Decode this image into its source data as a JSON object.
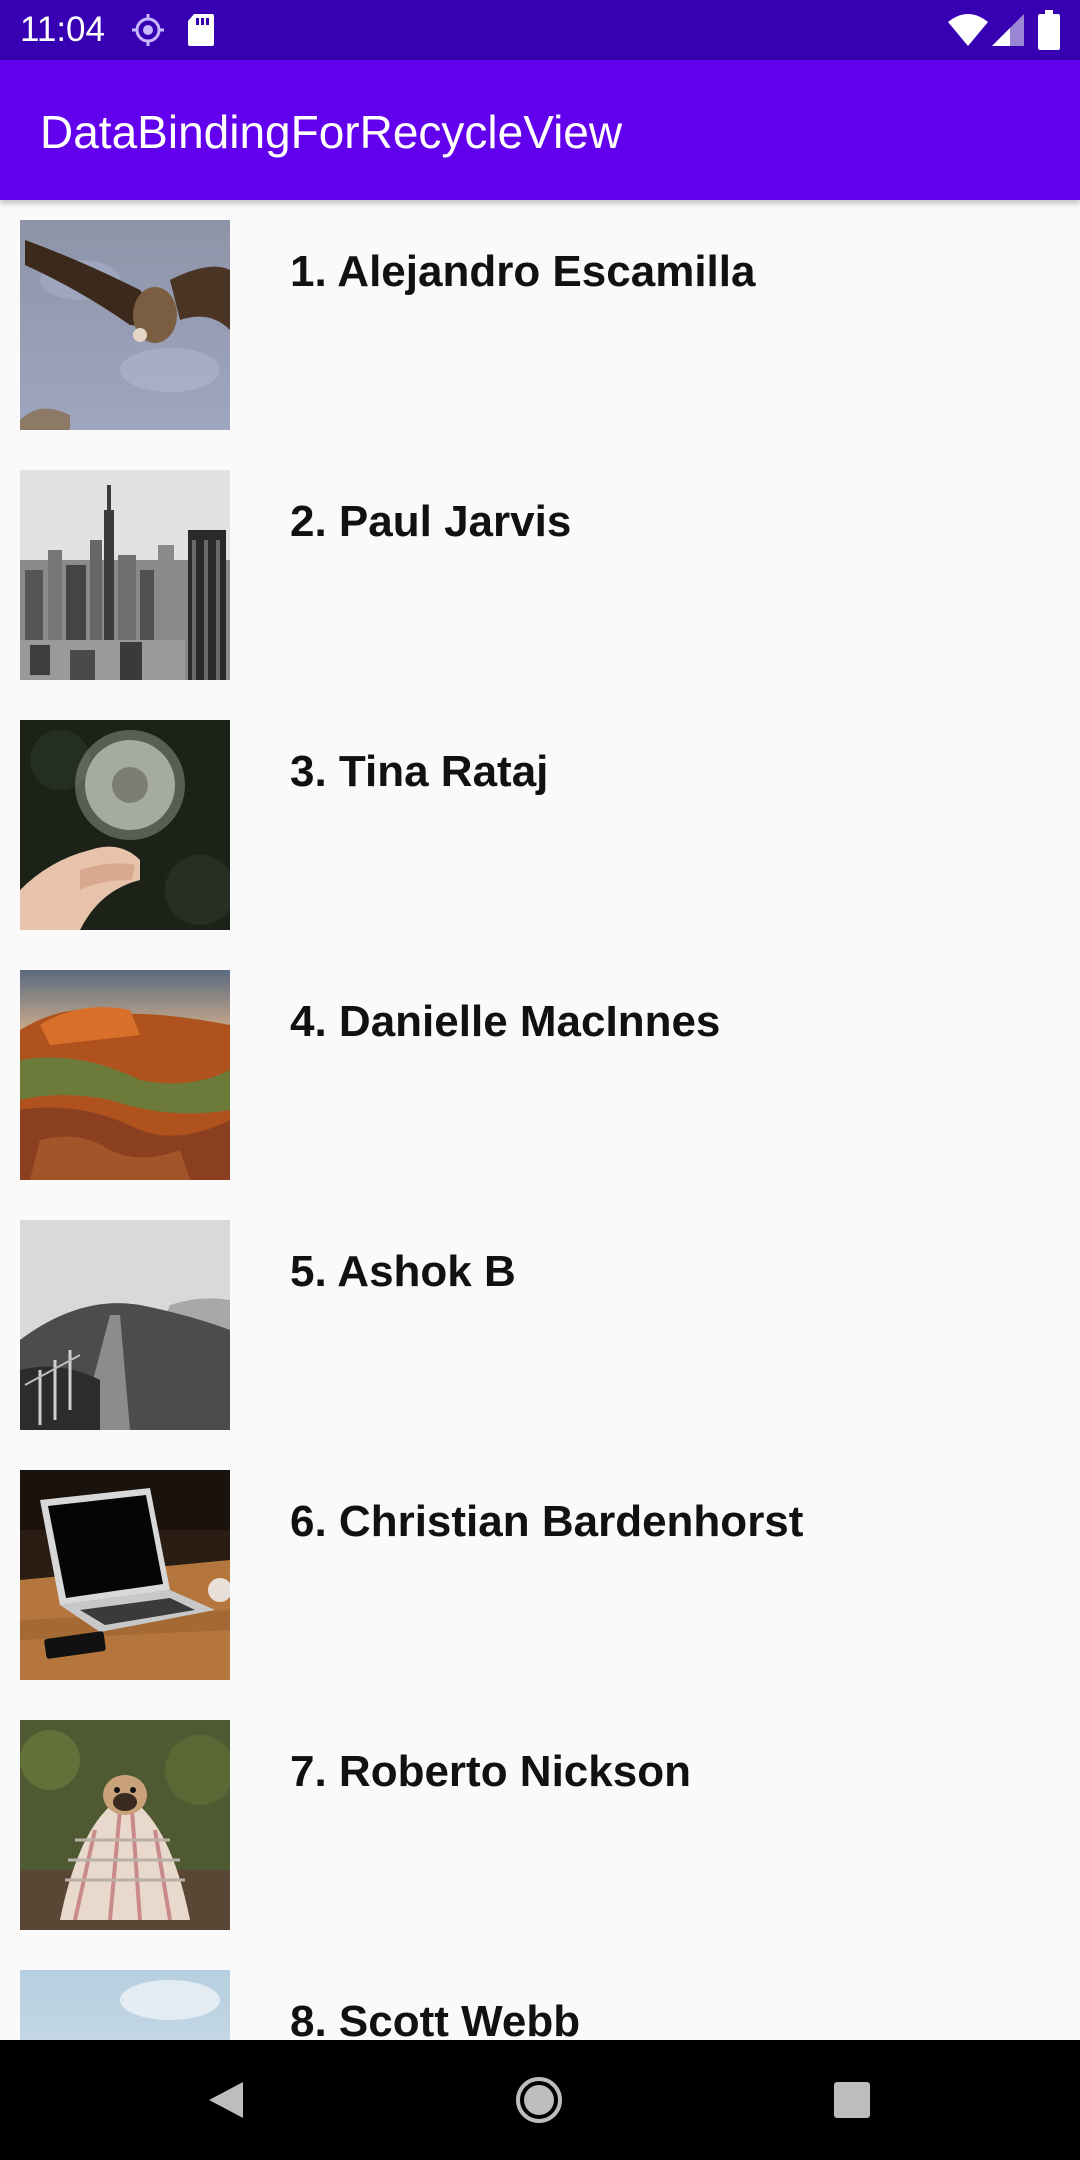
{
  "status_bar": {
    "time": "11:04",
    "icons": [
      "location-icon",
      "sd-card-icon",
      "wifi-icon",
      "signal-icon",
      "battery-icon"
    ]
  },
  "app_bar": {
    "title": "DataBindingForRecycleView"
  },
  "list": {
    "items": [
      {
        "title": "1. Alejandro Escamilla",
        "image": "vulture-photo"
      },
      {
        "title": "2. Paul Jarvis",
        "image": "city-skyline-photo"
      },
      {
        "title": "3. Tina Rataj",
        "image": "dandelion-photo"
      },
      {
        "title": "4. Danielle MacInnes",
        "image": "canyon-photo"
      },
      {
        "title": "5. Ashok B",
        "image": "hill-path-photo"
      },
      {
        "title": "6. Christian Bardenhorst",
        "image": "laptop-photo"
      },
      {
        "title": "7. Roberto Nickson",
        "image": "pug-blanket-photo"
      },
      {
        "title": "8. Scott Webb",
        "image": "sky-photo"
      }
    ]
  },
  "nav_bar": {
    "buttons": [
      "back-icon",
      "home-icon",
      "recents-icon"
    ]
  },
  "colors": {
    "status_bar": "#3700b3",
    "app_bar": "#6200ee",
    "background": "#fafafa",
    "nav_bar": "#000000"
  }
}
